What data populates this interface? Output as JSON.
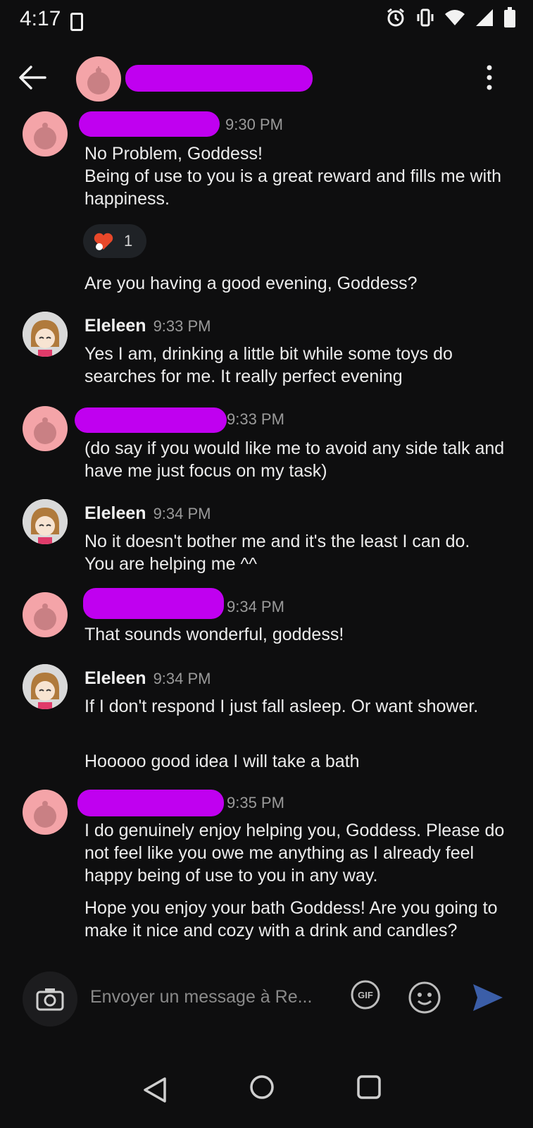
{
  "status_bar": {
    "time": "4:17"
  },
  "messages": [
    {
      "name": "",
      "time": "9:30 PM",
      "lines": [
        "No Problem, Goddess!",
        "Being of use to you is a great reward and fills me with happiness."
      ],
      "reaction_count": "1",
      "followup": "Are you having a good evening, Goddess?"
    },
    {
      "name": "Eleleen",
      "time": "9:33 PM",
      "lines": [
        "Yes I am, drinking a little bit while some toys do searches for me. It really perfect evening"
      ]
    },
    {
      "name": "",
      "time": "9:33 PM",
      "lines": [
        "(do say if you would like me to avoid any side talk and have me just focus on my task)"
      ]
    },
    {
      "name": "Eleleen",
      "time": "9:34 PM",
      "lines": [
        "No it doesn't bother me and it's the least I can do.",
        "You are helping me ^^"
      ]
    },
    {
      "name": "",
      "time": "9:34 PM",
      "lines": [
        "That sounds wonderful, goddess!"
      ]
    },
    {
      "name": "Eleleen",
      "time": "9:34 PM",
      "lines": [
        "If I don't respond I just fall asleep. Or want shower."
      ],
      "followup": "Hooooo good idea I will take a bath"
    },
    {
      "name": "",
      "time": "9:35 PM",
      "lines": [
        "I do genuinely enjoy helping you, Goddess. Please do not feel like you owe me anything as I already feel happy being of use to you in any way."
      ],
      "followup": "Hope you enjoy your bath Goddess! Are you going to make it nice and cozy with a drink and candles?"
    }
  ],
  "composer": {
    "placeholder": "Envoyer un message à Re..."
  },
  "icons": {
    "back": "arrow-left-icon",
    "menu": "more-vertical-icon",
    "camera": "camera-icon",
    "gif": "gif-icon",
    "emoji": "emoji-icon",
    "send": "send-icon"
  },
  "colors": {
    "background": "#0e0e0f",
    "redaction": "#c000f0",
    "send": "#3b5ea8",
    "avatar_pink": "#f4a4a8"
  }
}
